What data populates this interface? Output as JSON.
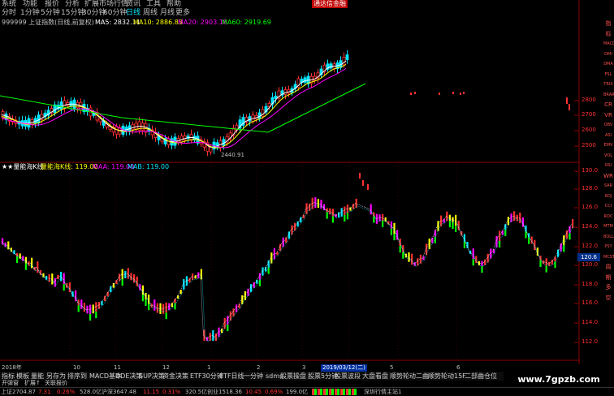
{
  "menu": [
    "系统",
    "功能",
    "报价",
    "分析",
    "扩展市场行情",
    "资讯",
    "工具",
    "帮助"
  ],
  "promo": "通达信金融",
  "periods": [
    "分时",
    "1分钟",
    "5分钟",
    "15分钟",
    "30分钟",
    "60分钟",
    "日线",
    "周线",
    "月线",
    "更多"
  ],
  "active_period": "日线",
  "price_info": {
    "symbol": "999999 上证指数(日线,前复权)",
    "ma5": "MA5: 2832.11",
    "ma10": "MA10: 2886.83",
    "ma20": "MA20: 2903.18",
    "ma60": "MA60: 2919.69",
    "low_label": "2440.91"
  },
  "indicator_info": {
    "name": "★★量能海K线",
    "name2": "量能海K线: 119.00",
    "maa": "MAA: 119.00",
    "mab": "MAB: 119.00"
  },
  "price_axis": [
    "2800",
    "2700",
    "2600",
    "2500"
  ],
  "indicator_axis": [
    "130.0",
    "128.0",
    "126.0",
    "124.0",
    "122.0",
    "120.0",
    "118.0",
    "116.0",
    "114.0",
    "112.0"
  ],
  "current_value": "120.6",
  "sidebar_buttons": [
    "指",
    "标",
    "MACD",
    "DMI",
    "DMA",
    "FSL",
    "TRIX",
    "BRAR",
    "CR",
    "VR",
    "OBV",
    "ASI",
    "EMV",
    "VOL",
    "RSI",
    "WR",
    "SAR",
    "KDJ",
    "CCI",
    "ROC",
    "MTM",
    "BOLL",
    "PSY",
    "MCST",
    "周",
    "期",
    "多",
    "空"
  ],
  "time_axis": [
    "2018年",
    "",
    "10",
    "11",
    "12",
    "1",
    "2",
    "3",
    "2019/03/12(二)",
    "5",
    "6"
  ],
  "tabs": [
    "指标",
    "模板",
    "量能",
    "另存为",
    "排序到",
    "MACD基本",
    "DDE决策",
    "SUP决策",
    "资金决策",
    "ETF30分钟",
    "ETF日线",
    "一分钟",
    "sdms",
    "股票操盘",
    "股票5分钟",
    "股票波段",
    "大盘看盘",
    "顺势轮动二曲",
    "顺势轮动15F",
    "二部曲仓位"
  ],
  "tabs2": [
    "开弹窗",
    "扩展↑",
    "关联报价"
  ],
  "status": {
    "sh": "上证2704.87",
    "sh_chg": "7.31",
    "sh_pct": "0.26%",
    "sh_vol": "528.0亿",
    "sz": "沪深3647.48",
    "sz_chg": "11.15",
    "sz_pct": "0.31%",
    "sz_vol": "320.5亿",
    "cy": "创业1518.36",
    "cy_chg": "10.45",
    "cy_pct": "0.69%",
    "cy_vol": "199.0亿",
    "server": "深圳行情主站1"
  },
  "watermark": "www.7gpzb.com",
  "colors": {
    "up": "#ff3030",
    "down": "#00e5ff",
    "green": "#00ff00",
    "yellow": "#ffff00",
    "magenta": "#ff00ff",
    "background": "#000000"
  }
}
